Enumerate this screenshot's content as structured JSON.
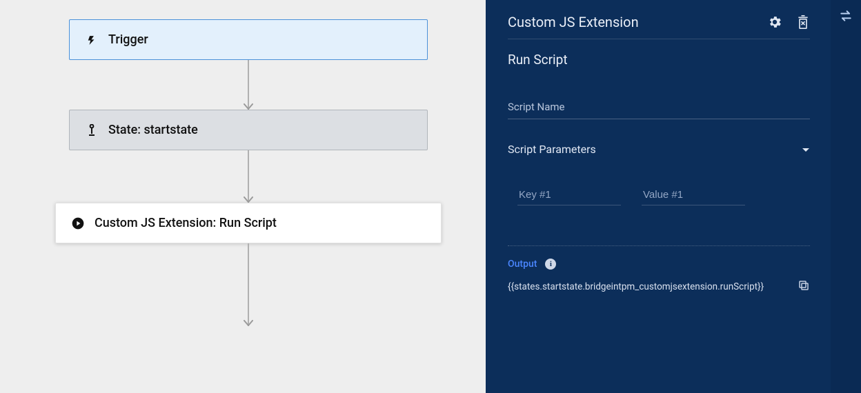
{
  "flow": {
    "trigger_label": "Trigger",
    "state_label": "State: startstate",
    "action_label": "Custom JS Extension: Run Script"
  },
  "panel": {
    "title": "Custom JS Extension",
    "subtitle": "Run Script",
    "script_name_label": "Script Name",
    "script_name_value": "",
    "parameters_label": "Script Parameters",
    "kv": {
      "key_placeholder": "Key #1",
      "value_placeholder": "Value #1",
      "key_value": "",
      "value_value": ""
    },
    "output_label": "Output",
    "output_expression": "{{states.startstate.bridgeintpm_customjsextension.runScript}}"
  },
  "icons": {
    "bolt": "bolt-icon",
    "state": "state-icon",
    "play": "play-icon",
    "gear": "gear-icon",
    "delete": "delete-icon",
    "caret": "caret-down-icon",
    "info": "info-icon",
    "copy": "copy-icon",
    "swap": "swap-icon"
  }
}
